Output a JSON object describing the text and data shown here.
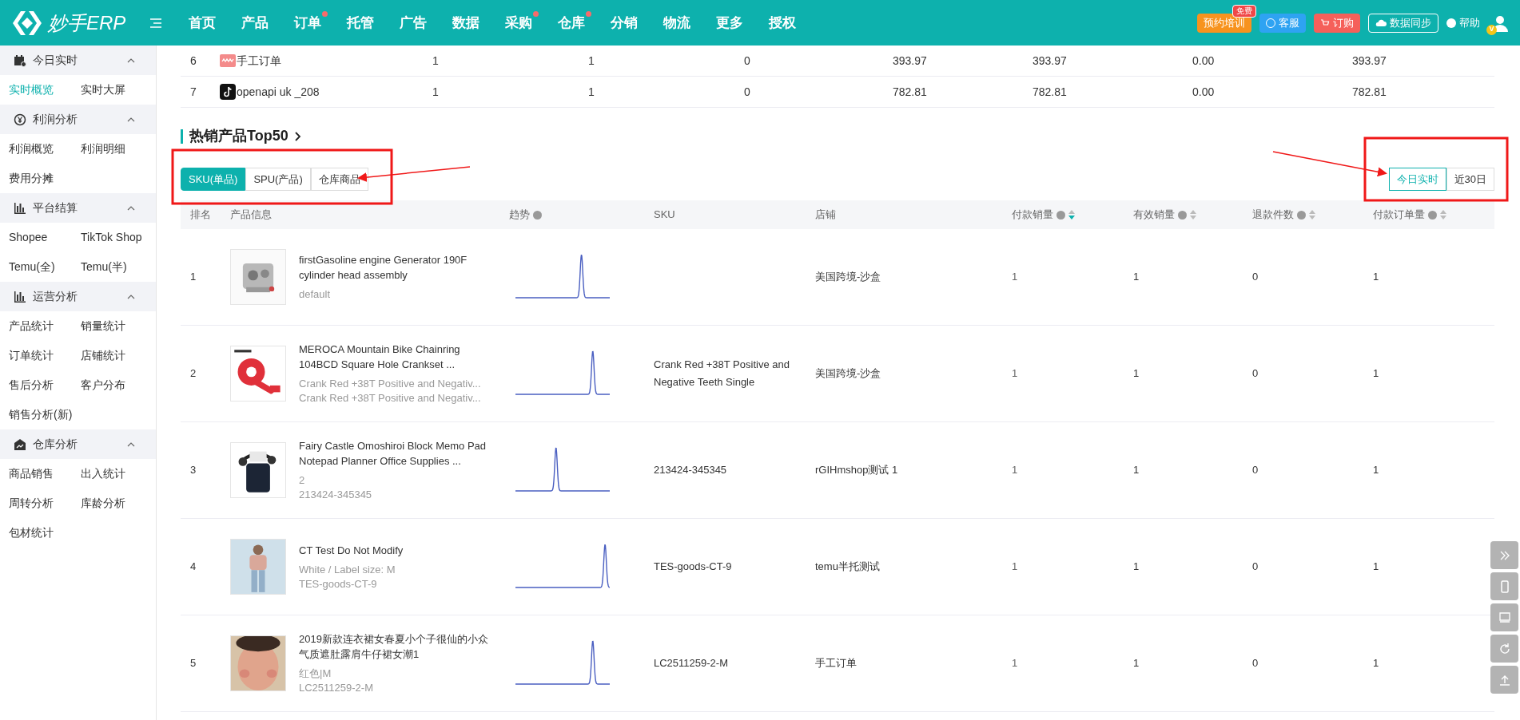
{
  "nav": {
    "logo": "妙手ERP",
    "items": [
      {
        "label": "首页",
        "dot": false
      },
      {
        "label": "产品",
        "dot": false
      },
      {
        "label": "订单",
        "dot": true
      },
      {
        "label": "托管",
        "dot": false
      },
      {
        "label": "广告",
        "dot": false
      },
      {
        "label": "数据",
        "dot": false
      },
      {
        "label": "采购",
        "dot": true
      },
      {
        "label": "仓库",
        "dot": true
      },
      {
        "label": "分销",
        "dot": false
      },
      {
        "label": "物流",
        "dot": false
      },
      {
        "label": "更多",
        "dot": false
      },
      {
        "label": "授权",
        "dot": false
      }
    ],
    "actions": [
      {
        "label": "预约培训",
        "kind": "orange",
        "badge": "免费"
      },
      {
        "label": "客服",
        "kind": "blue"
      },
      {
        "label": "订购",
        "kind": "red"
      },
      {
        "label": "数据同步",
        "kind": "outline"
      },
      {
        "label": "帮助",
        "kind": "plain"
      }
    ],
    "avatar_badge": "V"
  },
  "sidebar": {
    "groups": [
      {
        "title": "今日实时",
        "expanded": true,
        "items": [
          {
            "label": "实时概览",
            "selected": true
          },
          {
            "label": "实时大屏",
            "selected": false
          }
        ]
      },
      {
        "title": "利润分析",
        "expanded": true,
        "items": [
          {
            "label": "利润概览",
            "selected": false
          },
          {
            "label": "利润明细",
            "selected": false
          },
          {
            "label": "费用分摊",
            "selected": false
          }
        ]
      },
      {
        "title": "平台结算",
        "expanded": true,
        "items": [
          {
            "label": "Shopee",
            "selected": false
          },
          {
            "label": "TikTok Shop",
            "selected": false
          },
          {
            "label": "Temu(全)",
            "selected": false
          },
          {
            "label": "Temu(半)",
            "selected": false
          }
        ]
      },
      {
        "title": "运营分析",
        "expanded": true,
        "items": [
          {
            "label": "产品统计",
            "selected": false
          },
          {
            "label": "销量统计",
            "selected": false
          },
          {
            "label": "订单统计",
            "selected": false
          },
          {
            "label": "店铺统计",
            "selected": false
          },
          {
            "label": "售后分析",
            "selected": false
          },
          {
            "label": "客户分布",
            "selected": false
          },
          {
            "label": "销售分析(新)",
            "selected": false
          }
        ]
      },
      {
        "title": "仓库分析",
        "expanded": true,
        "items": [
          {
            "label": "商品销售",
            "selected": false
          },
          {
            "label": "出入统计",
            "selected": false
          },
          {
            "label": "周转分析",
            "selected": false
          },
          {
            "label": "库龄分析",
            "selected": false
          },
          {
            "label": "包材统计",
            "selected": false
          }
        ]
      }
    ]
  },
  "store_table": {
    "rows": [
      {
        "index": "6",
        "store": "手工订单",
        "cells": [
          "1",
          "1",
          "0",
          "393.97",
          "393.97",
          "0.00",
          "393.97"
        ]
      },
      {
        "index": "7",
        "store": "openapi uk _208",
        "cells": [
          "1",
          "1",
          "0",
          "782.81",
          "782.81",
          "0.00",
          "782.81"
        ]
      }
    ]
  },
  "hot_products": {
    "title": "热销产品Top50",
    "tabs": [
      {
        "label": "SKU(单品)",
        "selected": true
      },
      {
        "label": "SPU(产品)",
        "selected": false
      },
      {
        "label": "仓库商品",
        "selected": false
      }
    ],
    "range_tabs": [
      {
        "label": "今日实时",
        "selected": true
      },
      {
        "label": "近30日",
        "selected": false
      }
    ],
    "columns": [
      {
        "label": "排名",
        "help": false,
        "sortable": false
      },
      {
        "label": "产品信息",
        "help": false,
        "sortable": false
      },
      {
        "label": "趋势",
        "help": true,
        "sortable": false
      },
      {
        "label": "SKU",
        "help": false,
        "sortable": false
      },
      {
        "label": "店铺",
        "help": false,
        "sortable": false
      },
      {
        "label": "付款销量",
        "help": true,
        "sortable": true,
        "sorted": true
      },
      {
        "label": "有效销量",
        "help": true,
        "sortable": true,
        "sorted": false
      },
      {
        "label": "退款件数",
        "help": true,
        "sortable": true,
        "sorted": false
      },
      {
        "label": "付款订单量",
        "help": true,
        "sortable": true,
        "sorted": false
      }
    ],
    "rows": [
      {
        "rank": "1",
        "title": "firstGasoline engine Generator 190F cylinder head assembly",
        "details": [
          "default"
        ],
        "sku": "",
        "store": "美国跨境-沙盒",
        "cells": [
          "1",
          "1",
          "0",
          "1"
        ]
      },
      {
        "rank": "2",
        "title": "MEROCA Mountain Bike Chainring 104BCD Square Hole Crankset ...",
        "details": [
          "Crank Red +38T Positive and Negativ...",
          "Crank Red +38T Positive and Negativ..."
        ],
        "sku": "Crank Red +38T Positive and Negative Teeth Single",
        "store": "美国跨境-沙盒",
        "cells": [
          "1",
          "1",
          "0",
          "1"
        ]
      },
      {
        "rank": "3",
        "title": "Fairy Castle Omoshiroi Block Memo Pad Notepad Planner Office Supplies ...",
        "details": [
          "2",
          "213424-345345"
        ],
        "sku": "213424-345345",
        "store": "rGIHmshop测试 1",
        "cells": [
          "1",
          "1",
          "0",
          "1"
        ]
      },
      {
        "rank": "4",
        "title": "CT Test Do Not Modify",
        "details": [
          "White / Label size: M",
          "TES-goods-CT-9"
        ],
        "sku": "TES-goods-CT-9",
        "store": "temu半托测试",
        "cells": [
          "1",
          "1",
          "0",
          "1"
        ]
      },
      {
        "rank": "5",
        "title": "2019新款连衣裙女春夏小个子很仙的小众气质遮肚露肩牛仔裙女潮1",
        "details": [
          "红色|M",
          "LC2511259-2-M"
        ],
        "sku": "LC2511259-2-M",
        "store": "手工订单",
        "cells": [
          "1",
          "1",
          "0",
          "1"
        ]
      }
    ]
  }
}
